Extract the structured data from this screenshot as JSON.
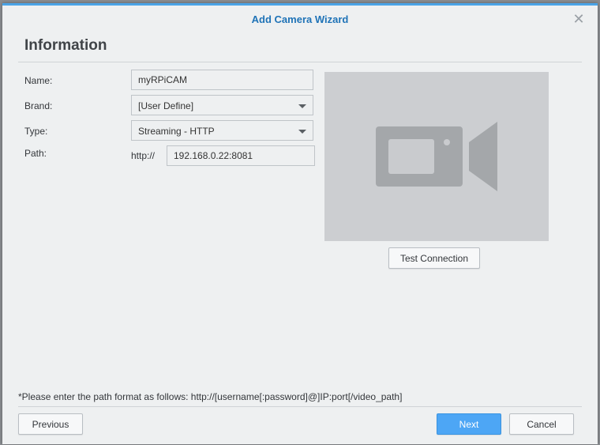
{
  "dialog": {
    "title": "Add Camera Wizard",
    "close_icon": "close-icon"
  },
  "section": {
    "title": "Information"
  },
  "form": {
    "name": {
      "label": "Name:",
      "value": "myRPiCAM"
    },
    "brand": {
      "label": "Brand:",
      "value": "[User Define]"
    },
    "type": {
      "label": "Type:",
      "value": "Streaming - HTTP"
    },
    "path": {
      "label": "Path:",
      "prefix": "http://",
      "value": "192.168.0.22:8081"
    }
  },
  "preview": {
    "icon": "video-camera-icon"
  },
  "buttons": {
    "test_connection": "Test Connection",
    "previous": "Previous",
    "next": "Next",
    "cancel": "Cancel"
  },
  "hint": "*Please enter the path format as follows: http://[username[:password]@]IP:port[/video_path]",
  "colors": {
    "accent": "#4aa3e6",
    "title": "#1f73b7",
    "primary_button": "#4da6f5"
  }
}
